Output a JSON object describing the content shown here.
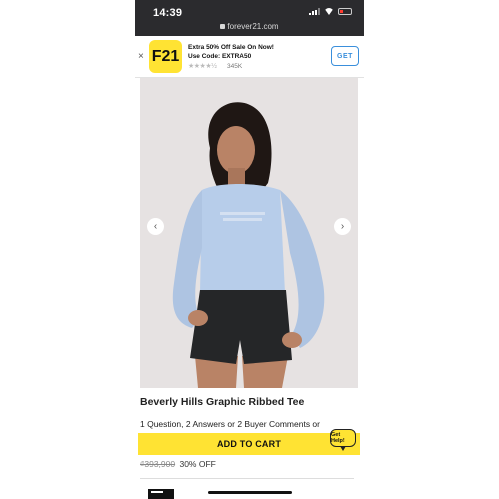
{
  "status_bar": {
    "time": "14:39",
    "url": "forever21.com"
  },
  "promo_banner": {
    "logo_text": "F21",
    "headline": "Extra 50% Off Sale On Now!",
    "code_line": "Use Code: EXTRA50",
    "rating_stars": "★★★★½",
    "rating_count": "345K",
    "get_label": "GET",
    "close_symbol": "×"
  },
  "product": {
    "prev_symbol": "‹",
    "next_symbol": "›",
    "title": "Beverly Hills Graphic Ribbed Tee",
    "qa_text": "1 Question, 2 Answers or 2 Buyer Comments or",
    "add_to_cart_label": "ADD TO CART",
    "help_label": "Get Help!",
    "original_price": "₫393,900",
    "discount_text": "30% OFF"
  },
  "colors": {
    "brand_yellow": "#ffe333",
    "status_bar": "#2b2b2e",
    "get_blue": "#3a8fdc",
    "shirt_blue": "#b7cdea"
  }
}
